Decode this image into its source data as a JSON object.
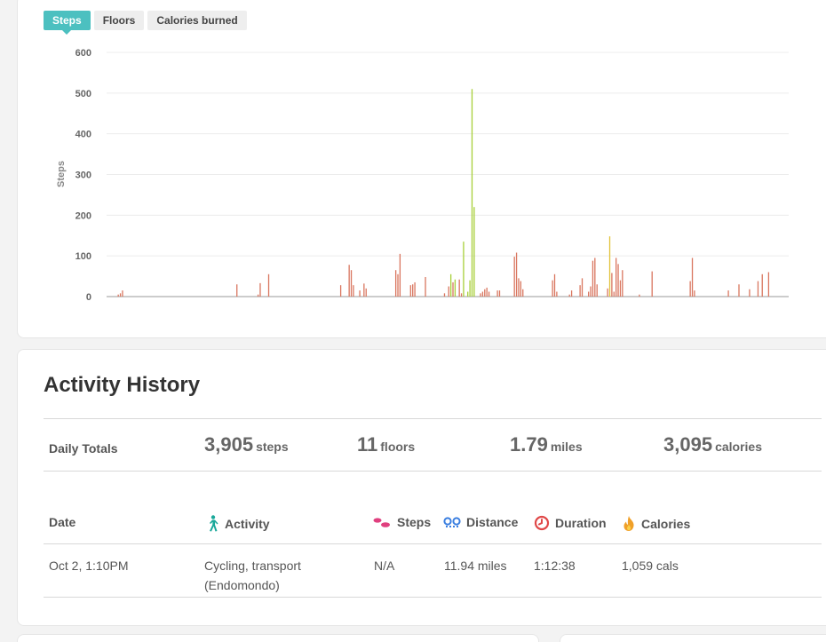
{
  "tabs": [
    "Steps",
    "Floors",
    "Calories burned"
  ],
  "chart_data": {
    "type": "bar",
    "ylabel": "Steps",
    "ylim": [
      0,
      600
    ],
    "yticks": [
      0,
      100,
      200,
      300,
      400,
      500,
      600
    ],
    "grid": true,
    "colors": {
      "low": "#d9765f",
      "mid": "#a7cf38",
      "high": "#e2c33a"
    },
    "values": [
      0,
      0,
      0,
      0,
      0,
      5,
      8,
      15,
      0,
      0,
      0,
      0,
      0,
      0,
      0,
      0,
      0,
      0,
      0,
      0,
      0,
      0,
      0,
      0,
      0,
      0,
      0,
      0,
      0,
      0,
      0,
      0,
      0,
      0,
      0,
      0,
      0,
      0,
      0,
      0,
      0,
      0,
      0,
      0,
      0,
      0,
      0,
      0,
      0,
      0,
      0,
      0,
      0,
      0,
      0,
      0,
      0,
      0,
      0,
      0,
      0,
      30,
      0,
      0,
      0,
      0,
      0,
      0,
      0,
      0,
      0,
      5,
      33,
      0,
      0,
      0,
      55,
      0,
      0,
      0,
      0,
      0,
      0,
      0,
      0,
      0,
      0,
      0,
      0,
      0,
      0,
      0,
      0,
      0,
      0,
      0,
      0,
      0,
      0,
      0,
      0,
      0,
      0,
      0,
      0,
      0,
      0,
      0,
      0,
      0,
      28,
      0,
      0,
      0,
      78,
      65,
      28,
      0,
      0,
      15,
      0,
      32,
      20,
      0,
      0,
      0,
      0,
      0,
      0,
      0,
      0,
      0,
      0,
      0,
      0,
      0,
      65,
      55,
      105,
      0,
      0,
      0,
      0,
      28,
      30,
      35,
      0,
      0,
      0,
      0,
      48,
      0,
      0,
      0,
      0,
      0,
      0,
      0,
      0,
      8,
      0,
      25,
      55,
      35,
      42,
      0,
      42,
      8,
      135,
      0,
      12,
      40,
      510,
      220,
      0,
      0,
      8,
      12,
      18,
      22,
      12,
      0,
      0,
      0,
      15,
      15,
      0,
      0,
      0,
      0,
      0,
      0,
      98,
      108,
      45,
      38,
      18,
      0,
      0,
      0,
      0,
      0,
      0,
      0,
      0,
      0,
      0,
      0,
      0,
      0,
      40,
      55,
      12,
      0,
      0,
      0,
      0,
      0,
      5,
      15,
      0,
      0,
      0,
      28,
      45,
      0,
      0,
      12,
      25,
      88,
      95,
      30,
      0,
      0,
      0,
      0,
      20,
      148,
      58,
      12,
      95,
      80,
      40,
      65,
      0,
      0,
      0,
      0,
      0,
      0,
      0,
      5,
      0,
      0,
      0,
      0,
      0,
      62,
      0,
      0,
      0,
      0,
      0,
      0,
      0,
      0,
      0,
      0,
      0,
      0,
      0,
      0,
      0,
      0,
      0,
      38,
      95,
      15,
      0,
      0,
      0,
      0,
      0,
      0,
      0,
      0,
      0,
      0,
      0,
      0,
      0,
      0,
      0,
      15,
      0,
      0,
      0,
      0,
      30,
      0,
      0,
      0,
      0,
      18,
      0,
      0,
      0,
      38,
      0,
      55,
      0,
      0,
      60,
      0,
      0,
      0,
      0,
      0,
      0,
      0,
      0,
      0
    ]
  },
  "activity": {
    "title": "Activity History",
    "daily_totals_label": "Daily Totals",
    "totals": [
      {
        "num": "3,905",
        "unit": "steps"
      },
      {
        "num": "11",
        "unit": "floors"
      },
      {
        "num": "1.79",
        "unit": "miles"
      },
      {
        "num": "3,095",
        "unit": "calories"
      }
    ],
    "columns": {
      "date": "Date",
      "activity": "Activity",
      "steps": "Steps",
      "distance": "Distance",
      "duration": "Duration",
      "calories": "Calories"
    },
    "rows": [
      {
        "date": "Oct 2, 1:10PM",
        "activity_line1": "Cycling, transport",
        "activity_line2": "(Endomondo)",
        "steps": "N/A",
        "distance": "11.94 miles",
        "duration": "1:12:38",
        "calories": "1,059 cals"
      }
    ]
  },
  "icons": {
    "activity": "walking-person-icon",
    "steps": "footprints-icon",
    "distance": "route-pins-icon",
    "duration": "clock-icon",
    "calories": "flame-icon"
  }
}
